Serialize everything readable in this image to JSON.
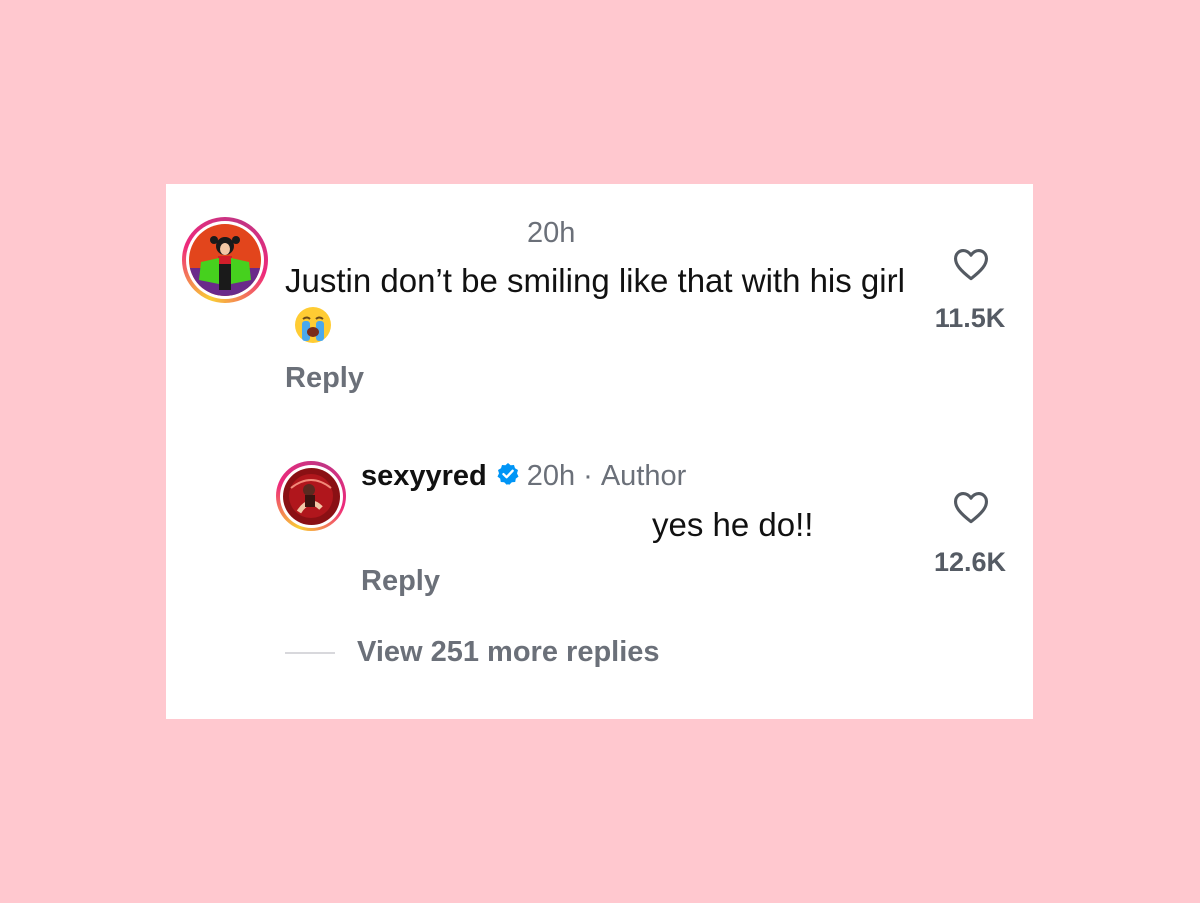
{
  "comment": {
    "username": "",
    "time": "20h",
    "text": "Justin don’t be smiling like that with his girl",
    "emoji": "loudly-crying-face-emoji",
    "reply_label": "Reply",
    "likes": "11.5K",
    "like_icon": "heart-icon"
  },
  "reply": {
    "username": "sexyyred",
    "verified_icon": "verified-badge-icon",
    "time": "20h",
    "separator": "·",
    "author_label": "Author",
    "text": "yes he do!!",
    "reply_label": "Reply",
    "likes": "12.6K",
    "like_icon": "heart-icon"
  },
  "view_more": {
    "label": "View 251 more replies"
  },
  "colors": {
    "background": "#ffc8cf",
    "card": "#ffffff",
    "text_primary": "#111111",
    "text_secondary": "#6b7079",
    "verified_blue": "#0095f6"
  }
}
